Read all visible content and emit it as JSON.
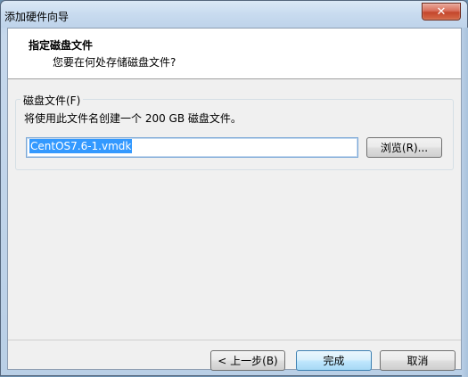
{
  "window": {
    "title": "添加硬件向导",
    "close_label": "✕"
  },
  "header": {
    "title": "指定磁盘文件",
    "subtitle": "您要在何处存储磁盘文件?"
  },
  "disk_file": {
    "legend": "磁盘文件(F)",
    "description": "将使用此文件名创建一个 200 GB 磁盘文件。",
    "value": "CentOS7.6-1.vmdk",
    "browse_label": "浏览(R)..."
  },
  "footer": {
    "back_label": "< 上一步(B)",
    "finish_label": "完成",
    "cancel_label": "取消"
  },
  "colors": {
    "accent": "#3399ff",
    "close": "#c4462c"
  }
}
